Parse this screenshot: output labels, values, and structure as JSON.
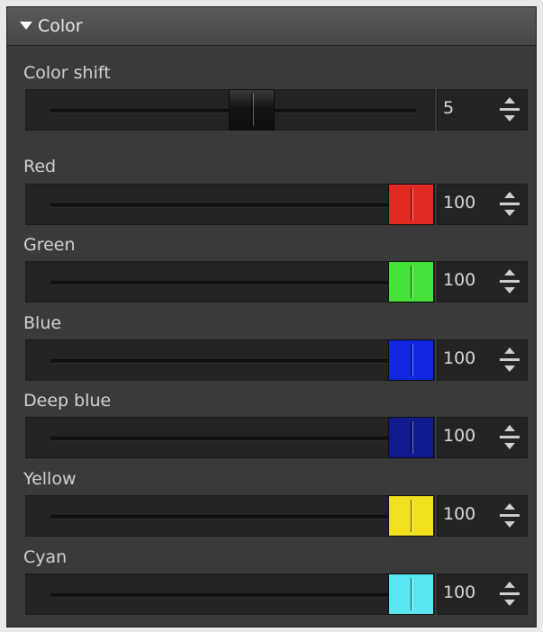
{
  "panel": {
    "title": "Color"
  },
  "sliders": [
    {
      "id": "color-shift",
      "label": "Color shift",
      "value": "5",
      "position": 0.56,
      "color": "#1a1a1a"
    },
    {
      "id": "red",
      "label": "Red",
      "value": "100",
      "position": 1.0,
      "color": "#e02a22"
    },
    {
      "id": "green",
      "label": "Green",
      "value": "100",
      "position": 1.0,
      "color": "#45e23a"
    },
    {
      "id": "blue",
      "label": "Blue",
      "value": "100",
      "position": 1.0,
      "color": "#1326e0"
    },
    {
      "id": "deep-blue",
      "label": "Deep blue",
      "value": "100",
      "position": 1.0,
      "color": "#101a8c"
    },
    {
      "id": "yellow",
      "label": "Yellow",
      "value": "100",
      "position": 1.0,
      "color": "#f0e020"
    },
    {
      "id": "cyan",
      "label": "Cyan",
      "value": "100",
      "position": 1.0,
      "color": "#58e6f0"
    }
  ]
}
